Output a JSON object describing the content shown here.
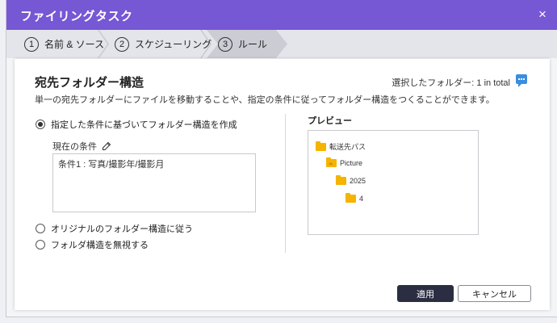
{
  "window": {
    "title": "ファイリングタスク",
    "close_icon": "×"
  },
  "steps": [
    {
      "num": "1",
      "label": "名前 & ソース"
    },
    {
      "num": "2",
      "label": "スケジューリング"
    },
    {
      "num": "3",
      "label": "ルール",
      "active": true
    }
  ],
  "section": {
    "title": "宛先フォルダー構造",
    "selected_info": "選択したフォルダー: 1 in total",
    "description": "単一の宛先フォルダーにファイルを移動することや、指定の条件に従ってフォルダー構造をつくることができます。"
  },
  "options": {
    "opt1": "指定した条件に基づいてフォルダー構造を作成",
    "opt2": "オリジナルのフォルダー構造に従う",
    "opt3": "フォルダ構造を無視する",
    "selected": "opt1"
  },
  "condition": {
    "label": "現在の条件",
    "value": "条件1 : 写真/撮影年/撮影月"
  },
  "preview": {
    "label": "プレビュー",
    "tree": [
      {
        "name": "転送先パス",
        "depth": 0,
        "icon": "folder-icon"
      },
      {
        "name": "Picture",
        "depth": 1,
        "icon": "picture-folder-icon"
      },
      {
        "name": "2025",
        "depth": 2,
        "icon": "folder-icon"
      },
      {
        "name": "4",
        "depth": 3,
        "icon": "folder-icon"
      }
    ]
  },
  "buttons": {
    "apply": "適用",
    "cancel": "キャンセル"
  },
  "colors": {
    "titlebar": "#7657d4",
    "apply_button": "#2b2d42",
    "folder": "#f4b400",
    "chat_icon": "#3b8de0"
  }
}
